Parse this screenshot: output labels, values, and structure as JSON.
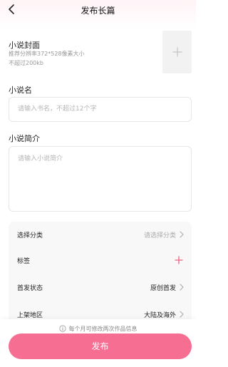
{
  "header": {
    "back_icon": "chevron-left-icon",
    "title": "发布长篇"
  },
  "cover": {
    "label": "小说封面",
    "hint_resolution": "推荐分辨率372*528像素大小",
    "hint_size": "不超过200kb",
    "add_icon": "plus-icon"
  },
  "name": {
    "label": "小说名",
    "placeholder": "请输入书名，不超过12个字"
  },
  "intro": {
    "label": "小说简介",
    "placeholder": "请输入小说简介"
  },
  "settings": {
    "rows": [
      {
        "label": "选择分类",
        "value": "请选择分类",
        "control": "chevron-right-icon"
      },
      {
        "label": "标签",
        "value": "",
        "control": "plus-icon"
      },
      {
        "label": "首发状态",
        "value": "原创首发",
        "control": "chevron-right-icon"
      },
      {
        "label": "上架地区",
        "value": "大陆及海外",
        "control": "chevron-right-icon"
      }
    ]
  },
  "footer": {
    "notice_icon": "info-icon",
    "notice": "每个月可修改两次作品信息",
    "publish_label": "发布"
  },
  "colors": {
    "accent": "#f76e93",
    "plus": "#f0607f"
  }
}
